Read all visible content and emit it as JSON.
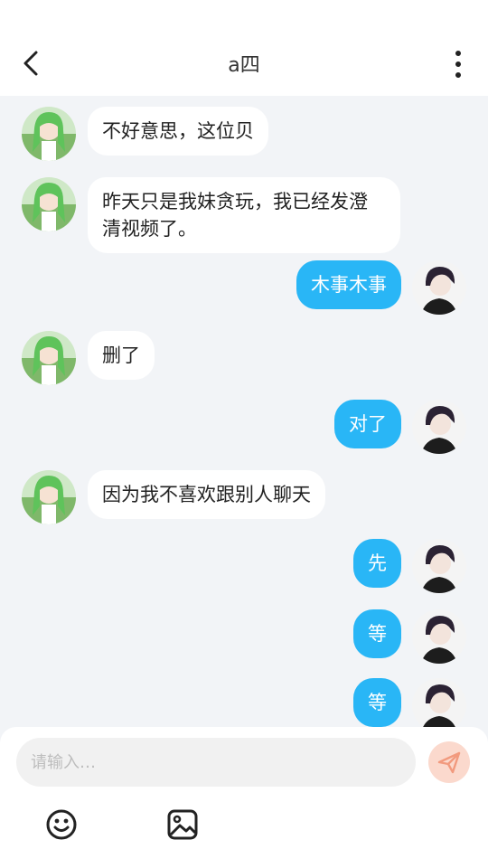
{
  "header": {
    "title": "a四"
  },
  "messages": [
    {
      "side": "left",
      "text": "不好意思，这位贝"
    },
    {
      "side": "left",
      "text": "昨天只是我妹贪玩，我已经发澄清视频了。"
    },
    {
      "side": "right",
      "text": "木事木事"
    },
    {
      "side": "left",
      "text": "删了"
    },
    {
      "side": "right",
      "text": "对了"
    },
    {
      "side": "left",
      "text": "因为我不喜欢跟别人聊天"
    },
    {
      "side": "right",
      "text": "先"
    },
    {
      "side": "right",
      "text": "等"
    },
    {
      "side": "right",
      "text": "等"
    }
  ],
  "input": {
    "placeholder": "请输入…",
    "value": ""
  },
  "icons": {
    "back": "chevron-left-icon",
    "more": "more-vertical-icon",
    "send": "send-icon",
    "emoji": "emoji-icon",
    "image": "image-icon"
  },
  "colors": {
    "accent": "#29b6f6",
    "send_button": "#fbd9cd",
    "background": "#f2f4f7"
  }
}
